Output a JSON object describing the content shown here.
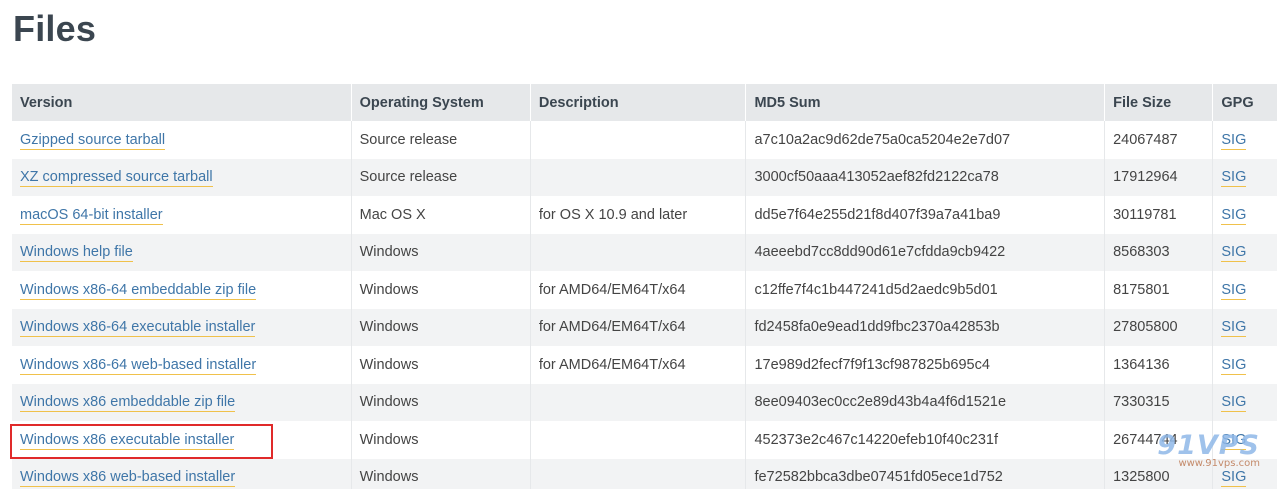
{
  "page": {
    "title": "Files"
  },
  "table": {
    "headers": {
      "version": "Version",
      "os": "Operating System",
      "description": "Description",
      "md5": "MD5 Sum",
      "size": "File Size",
      "gpg": "GPG"
    },
    "rows": [
      {
        "version": "Gzipped source tarball",
        "os": "Source release",
        "description": "",
        "md5": "a7c10a2ac9d62de75a0ca5204e2e7d07",
        "size": "24067487",
        "gpg": "SIG"
      },
      {
        "version": "XZ compressed source tarball",
        "os": "Source release",
        "description": "",
        "md5": "3000cf50aaa413052aef82fd2122ca78",
        "size": "17912964",
        "gpg": "SIG"
      },
      {
        "version": "macOS 64-bit installer",
        "os": "Mac OS X",
        "description": "for OS X 10.9 and later",
        "md5": "dd5e7f64e255d21f8d407f39a7a41ba9",
        "size": "30119781",
        "gpg": "SIG"
      },
      {
        "version": "Windows help file",
        "os": "Windows",
        "description": "",
        "md5": "4aeeebd7cc8dd90d61e7cfdda9cb9422",
        "size": "8568303",
        "gpg": "SIG"
      },
      {
        "version": "Windows x86-64 embeddable zip file",
        "os": "Windows",
        "description": "for AMD64/EM64T/x64",
        "md5": "c12ffe7f4c1b447241d5d2aedc9b5d01",
        "size": "8175801",
        "gpg": "SIG"
      },
      {
        "version": "Windows x86-64 executable installer",
        "os": "Windows",
        "description": "for AMD64/EM64T/x64",
        "md5": "fd2458fa0e9ead1dd9fbc2370a42853b",
        "size": "27805800",
        "gpg": "SIG"
      },
      {
        "version": "Windows x86-64 web-based installer",
        "os": "Windows",
        "description": "for AMD64/EM64T/x64",
        "md5": "17e989d2fecf7f9f13cf987825b695c4",
        "size": "1364136",
        "gpg": "SIG"
      },
      {
        "version": "Windows x86 embeddable zip file",
        "os": "Windows",
        "description": "",
        "md5": "8ee09403ec0cc2e89d43b4a4f6d1521e",
        "size": "7330315",
        "gpg": "SIG"
      },
      {
        "version": "Windows x86 executable installer",
        "os": "Windows",
        "description": "",
        "md5": "452373e2c467c14220efeb10f40c231f",
        "size": "26744744",
        "gpg": "SIG"
      },
      {
        "version": "Windows x86 web-based installer",
        "os": "Windows",
        "description": "",
        "md5": "fe72582bbca3dbe07451fd05ece1d752",
        "size": "1325800",
        "gpg": "SIG"
      }
    ]
  },
  "watermark": {
    "logo": "91VPS",
    "url": "www.91vps.com"
  },
  "colors": {
    "link": "#3f76a8",
    "link_underline": "#f0c14b",
    "header_bg": "#e6e8ea",
    "highlight_border": "#e02a2a"
  }
}
